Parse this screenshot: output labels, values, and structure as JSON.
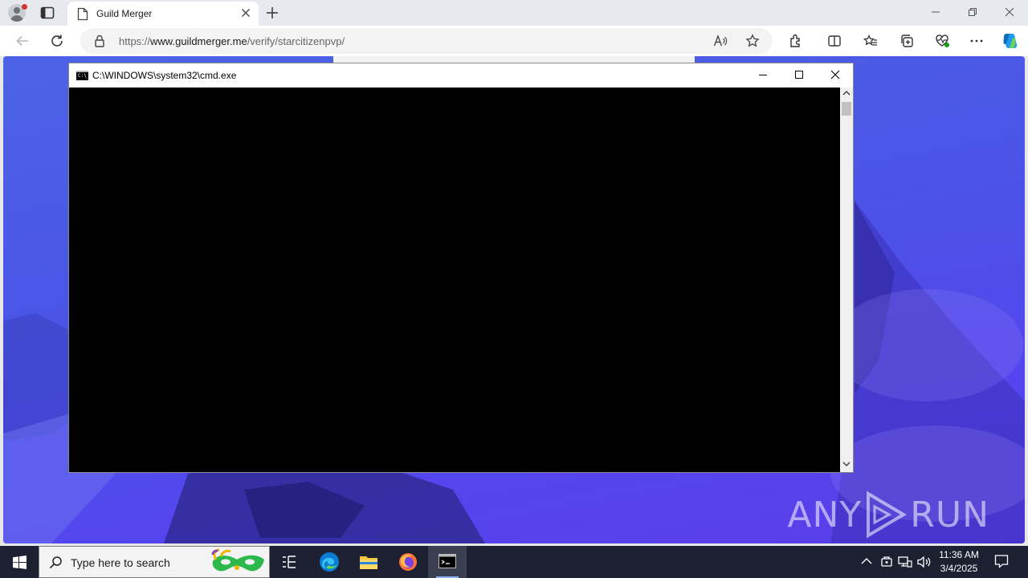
{
  "browser": {
    "tab_title": "Guild Merger",
    "url_prefix": "https://",
    "url_host": "www.guildmerger.me",
    "url_path": "/verify/starcitizenpvp/"
  },
  "cmd_window": {
    "title": "C:\\WINDOWS\\system32\\cmd.exe",
    "icon_text": "C:\\_"
  },
  "watermark": {
    "left": "ANY",
    "right": "RUN"
  },
  "taskbar": {
    "search_placeholder": "Type here to search",
    "time": "11:36 AM",
    "date": "3/4/2025"
  },
  "icons": {
    "start": "windows-logo-icon",
    "task_view": "task-view-icon",
    "edge": "edge-icon",
    "explorer": "file-explorer-icon",
    "firefox": "firefox-icon",
    "cmd": "cmd-icon"
  },
  "colors": {
    "desktop_bg": "#4a55e6",
    "taskbar_bg": "#1c2030",
    "copilot_accent": "#0f6cbd"
  }
}
